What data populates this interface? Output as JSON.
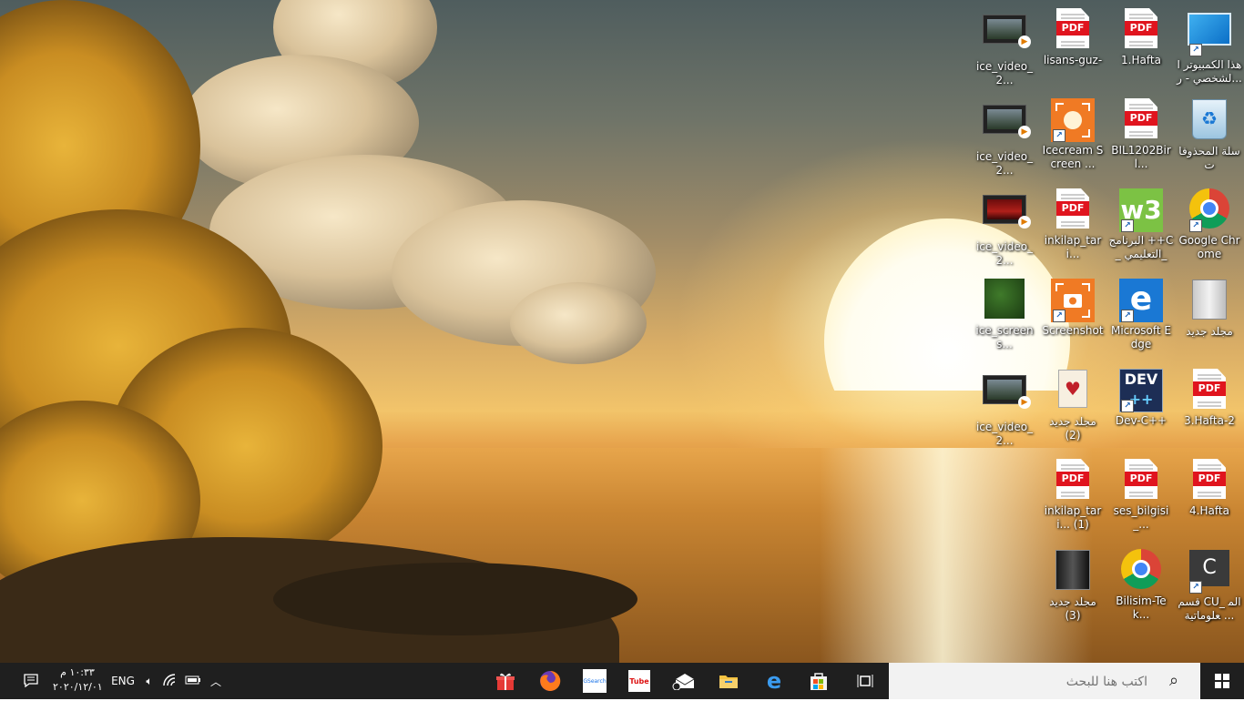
{
  "desktop": {
    "icons": [
      {
        "label": "هذا الكمبيوتر الشخصي - ر...",
        "icon": "computer-icon"
      },
      {
        "label": "1.Hafta",
        "icon": "pdf-icon"
      },
      {
        "label": "lisans-guz-",
        "icon": "pdf-icon"
      },
      {
        "label": "ice_video_2...",
        "icon": "video-icon"
      },
      {
        "label": "سلة المحذوفات",
        "icon": "recycle-bin-icon"
      },
      {
        "label": "BIL1202Birl...",
        "icon": "pdf-icon"
      },
      {
        "label": "Icecream Screen ...",
        "icon": "icecream-recorder-icon"
      },
      {
        "label": "ice_video_2...",
        "icon": "video-icon"
      },
      {
        "label": "Google Chrome",
        "icon": "chrome-icon"
      },
      {
        "label": "البرنامج ++C_ التعليمي_",
        "icon": "w3schools-icon"
      },
      {
        "label": "inkilap_tari...",
        "icon": "pdf-icon"
      },
      {
        "label": "ice_video_2...",
        "icon": "video-icon"
      },
      {
        "label": "مجلد جديد",
        "icon": "folder-icon"
      },
      {
        "label": "Microsoft Edge",
        "icon": "edge-icon"
      },
      {
        "label": "Screenshot",
        "icon": "screenshot-icon"
      },
      {
        "label": "ice_screens...",
        "icon": "image-icon"
      },
      {
        "label": "3.Hafta-2",
        "icon": "pdf-icon"
      },
      {
        "label": "Dev-C++",
        "icon": "devcpp-icon"
      },
      {
        "label": "مجلد جديد (2)",
        "icon": "card-folder-icon"
      },
      {
        "label": "ice_video_2...",
        "icon": "video-icon"
      },
      {
        "label": "4.Hafta",
        "icon": "pdf-icon"
      },
      {
        "label": "ses_bilgisi_...",
        "icon": "pdf-icon"
      },
      {
        "label": "inkilap_tari... (1)",
        "icon": "pdf-icon"
      },
      {
        "label": "قسم CU_ المعلوماتية ...",
        "icon": "c-letter-icon"
      },
      {
        "label": "Bilisim-Tek...",
        "icon": "chrome-icon"
      },
      {
        "label": "مجلد جديد (3)",
        "icon": "dark-folder-icon"
      }
    ],
    "pdf_tag": "PDF",
    "dev_tag": "DEV",
    "dev_sub": "++",
    "w3_text": "w3",
    "edge_letter": "e",
    "c_letter": "C"
  },
  "taskbar": {
    "search_placeholder": "اكتب هنا للبحث",
    "apps": [
      {
        "name": "task-view-icon"
      },
      {
        "name": "store-icon"
      },
      {
        "name": "edge-icon"
      },
      {
        "name": "file-explorer-icon"
      },
      {
        "name": "mail-icon"
      },
      {
        "name": "tubemate-icon",
        "label": "Tube"
      },
      {
        "name": "gsearch-icon",
        "label": "GSearch"
      },
      {
        "name": "firefox-icon"
      },
      {
        "name": "gift-icon"
      }
    ],
    "tray": {
      "language": "ENG",
      "time": "١٠:٣٣ م",
      "date": "٢٠٢٠/١٢/٠١"
    }
  },
  "colors": {
    "taskbar_bg": "#1f1f1f",
    "pdf_red": "#e0141e",
    "search_bg": "#f2f2f2"
  }
}
